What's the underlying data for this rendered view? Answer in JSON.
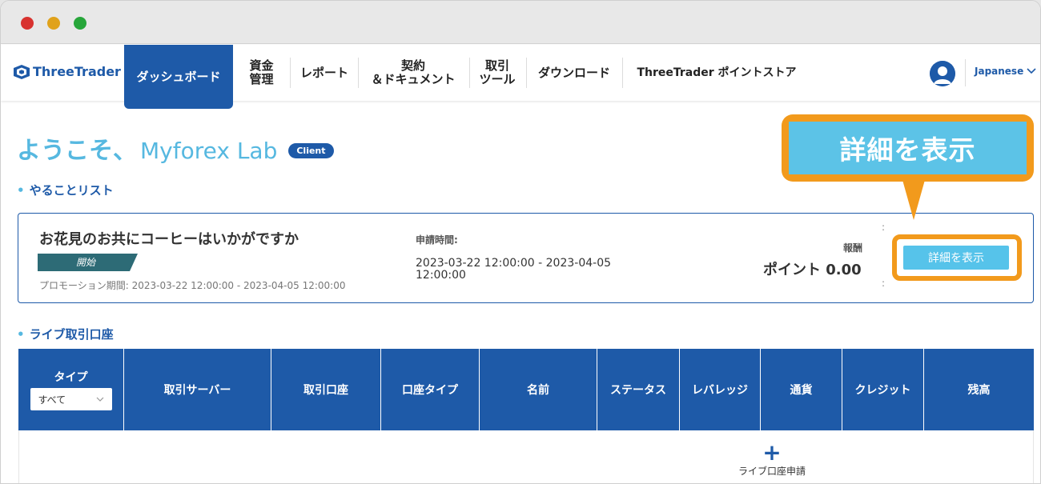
{
  "brand": {
    "name": "ThreeTrader",
    "accent": "#1e5aa8",
    "light": "#56b8e0",
    "highlight": "#f29a1c"
  },
  "nav": {
    "items": [
      {
        "label": "ダッシュボード",
        "active": true
      },
      {
        "label": "資金\n管理"
      },
      {
        "label": "レポート"
      },
      {
        "label": "契約\n＆ドキュメント"
      },
      {
        "label": "取引\nツール"
      },
      {
        "label": "ダウンロード"
      },
      {
        "label": "ThreeTrader ポイントストア"
      }
    ],
    "language": "Japanese"
  },
  "welcome": {
    "prefix": "ようこそ、",
    "name": "Myforex Lab",
    "badge": "Client"
  },
  "todo": {
    "section_title": "やることリスト",
    "promo_title": "お花見のお共にコーヒーはいかがですか",
    "status": "開始",
    "period": "プロモーション期間: 2023-03-22 12:00:00 - 2023-04-05 12:00:00",
    "apply_label": "申請時間:",
    "apply_time": "2023-03-22 12:00:00 - 2023-04-05 12:00:00",
    "reward_label": "報酬",
    "reward_value": "ポイント 0.00",
    "detail_button": "詳細を表示"
  },
  "callout": {
    "text": "詳細を表示"
  },
  "live": {
    "section_title": "ライブ取引口座",
    "columns": [
      "タイプ",
      "取引サーバー",
      "取引口座",
      "口座タイプ",
      "名前",
      "ステータス",
      "レバレッジ",
      "通貨",
      "クレジット",
      "残高"
    ],
    "type_filter": "すべて",
    "add_label": "ライブ口座申請"
  }
}
